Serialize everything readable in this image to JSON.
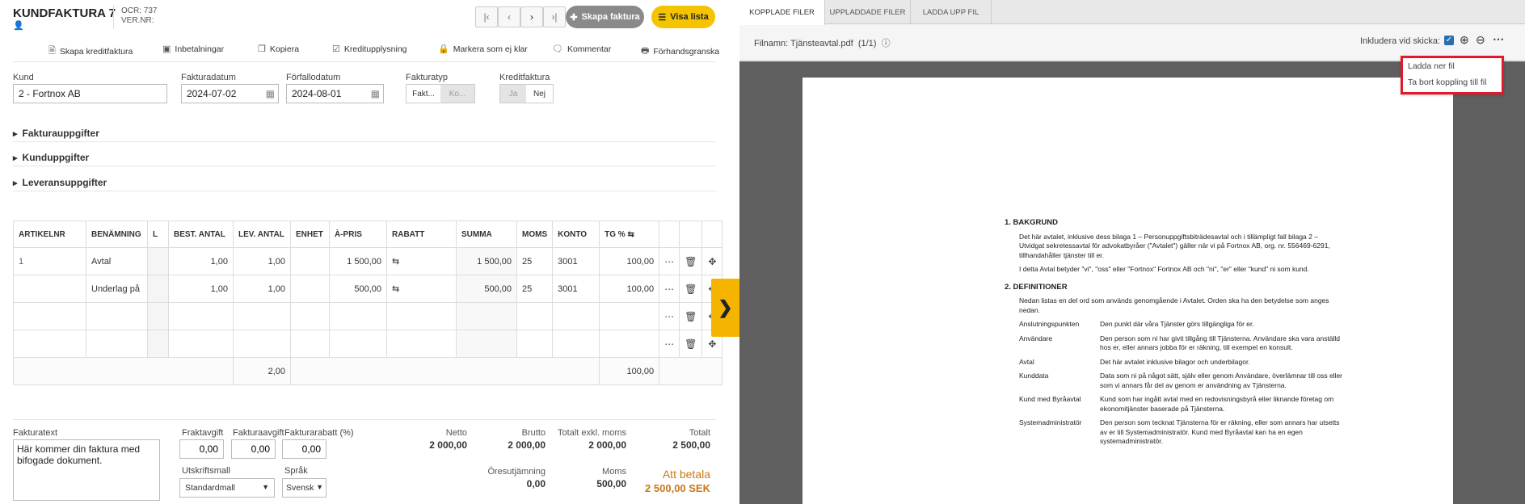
{
  "header": {
    "title": "KUNDFAKTURA 7",
    "ocr": "OCR: 737",
    "ver": "VER.NR:",
    "create_invoice": "Skapa faktura",
    "show_list": "Visa lista"
  },
  "toolbar": {
    "credit": "Skapa kreditfaktura",
    "payments": "Inbetalningar",
    "copy": "Kopiera",
    "credit_info": "Kreditupplysning",
    "mark_unready": "Markera som ej klar",
    "comment": "Kommentar",
    "preview": "Förhandsgranska"
  },
  "form": {
    "customer_label": "Kund",
    "customer": "2 - Fortnox AB",
    "invoice_date_label": "Fakturadatum",
    "invoice_date": "2024-07-02",
    "due_date_label": "Förfallodatum",
    "due_date": "2024-08-01",
    "type_label": "Fakturatyp",
    "type_opt1": "Fakt...",
    "type_opt2": "Ko...",
    "credit_label": "Kreditfaktura",
    "credit_yes": "Ja",
    "credit_no": "Nej"
  },
  "sections": {
    "invoice": "Fakturauppgifter",
    "customer": "Kunduppgifter",
    "delivery": "Leveransuppgifter"
  },
  "table": {
    "headers": [
      "ARTIKELNR",
      "BENÄMNING",
      "L",
      "BEST. ANTAL",
      "LEV. ANTAL",
      "ENHET",
      "À-PRIS",
      "RABATT",
      "SUMMA",
      "MOMS",
      "KONTO",
      "TG %"
    ],
    "rows": [
      {
        "art": "1",
        "name": "Avtal",
        "best": "1,00",
        "lev": "1,00",
        "price": "1 500,00",
        "sum": "1 500,00",
        "vat": "25",
        "acc": "3001",
        "tg": "100,00"
      },
      {
        "art": "",
        "name": "Underlag på",
        "best": "1,00",
        "lev": "1,00",
        "price": "500,00",
        "sum": "500,00",
        "vat": "25",
        "acc": "3001",
        "tg": "100,00"
      }
    ],
    "total_lev": "2,00",
    "total_tg": "100,00"
  },
  "footer": {
    "text_label": "Fakturatext",
    "text": "Här kommer din faktura med bifogade dokument.",
    "freight_label": "Fraktavgift",
    "freight": "0,00",
    "fee_label": "Fakturaavgift",
    "fee": "0,00",
    "discount_label": "Fakturarabatt (%)",
    "discount": "0,00",
    "print_label": "Utskriftsmall",
    "print": "Standardmall",
    "lang_label": "Språk",
    "lang": "Svensk",
    "net_label": "Netto",
    "net": "2 000,00",
    "gross_label": "Brutto",
    "gross": "2 000,00",
    "excl_label": "Totalt exkl. moms",
    "excl": "2 000,00",
    "total_label": "Totalt",
    "total": "2 500,00",
    "round_label": "Öresutjämning",
    "round": "0,00",
    "vat_label": "Moms",
    "vat": "500,00",
    "pay_label": "Att betala",
    "pay": "2 500,00 SEK"
  },
  "viewer": {
    "tab1": "KOPPLADE FILER",
    "tab2": "UPPLADDADE FILER",
    "tab3": "LADDA UPP FIL",
    "filename": "Filnamn: Tjänsteavtal.pdf",
    "pages": "(1/1)",
    "include": "Inkludera vid skicka:",
    "menu_download": "Ladda ner fil",
    "menu_remove": "Ta bort koppling till fil"
  },
  "document": {
    "h1": "1.    BAKGRUND",
    "p1": "Det här avtalet, inklusive dess bilaga 1 – Personuppgiftsbiträdesavtal och i tillämpligt fall bilaga 2 – Utvidgat sekretessavtal för advokatbyråer (\"Avtalet\") gäller när vi på Fortnox AB, org. nr. 556469-6291, tillhandahåller tjänster till er.",
    "p2": "I detta Avtal betyder \"vi\", \"oss\" eller \"Fortnox\" Fortnox AB och \"ni\", \"er\" eller \"kund\" ni som kund.",
    "h2": "2.    DEFINITIONER",
    "p3": "Nedan listas en del ord som används genomgående i Avtalet. Orden ska ha den betydelse som anges nedan.",
    "defs": [
      {
        "k": "Anslutningspunkten",
        "v": "Den punkt där våra Tjänster görs tillgängliga för er."
      },
      {
        "k": "Användare",
        "v": "Den person som ni har givit tillgång till Tjänsterna. Användare ska vara anställd hos er, eller annars jobba för er räkning, till exempel en konsult."
      },
      {
        "k": "Avtal",
        "v": "Det här avtalet inklusive bilagor och underbilagor."
      },
      {
        "k": "Kunddata",
        "v": "Data som ni på något sätt, själv eller genom Användare, överlämnar till oss eller som vi annars får del av genom er användning av Tjänsterna."
      },
      {
        "k": "Kund med Byråavtal",
        "v": "Kund som har ingått avtal med en redovisningsbyrå eller liknande företag om ekonomitjänster baserade på Tjänsterna."
      },
      {
        "k": "Systemadministratör",
        "v": "Den person som tecknat Tjänsterna för er räkning, eller som annars har utsetts av er till Systemadministratör. Kund med Byråavtal kan ha en egen systemadministratör."
      }
    ]
  },
  "colors": {
    "accent": "#f5b400",
    "gray_btn": "#8a8a8a",
    "highlight": "#e0192b",
    "pay": "#c8771a"
  }
}
